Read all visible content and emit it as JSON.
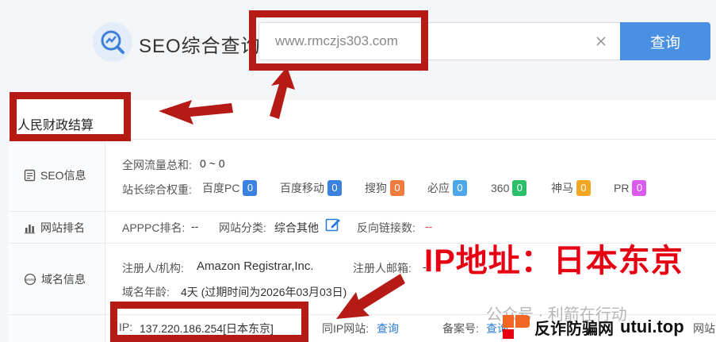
{
  "header": {
    "title": "SEO综合查询",
    "search_value": "www.rmczjs303.com",
    "search_button": "查询"
  },
  "site": {
    "name": "人民财政结算"
  },
  "sections": {
    "seo": "SEO信息",
    "rank": "网站排名",
    "domain": "域名信息"
  },
  "seo_info": {
    "traffic_label": "全网流量总和:",
    "traffic_value": "0 ~ 0",
    "weight_label": "站长综合权重:",
    "weights": [
      {
        "name": "百度PC",
        "value": "0",
        "color": "#3b82e0"
      },
      {
        "name": "百度移动",
        "value": "0",
        "color": "#3b82e0"
      },
      {
        "name": "搜狗",
        "value": "0",
        "color": "#f07b3f"
      },
      {
        "name": "必应",
        "value": "0",
        "color": "#4ea7e8"
      },
      {
        "name": "360",
        "value": "0",
        "color": "#2bbf6a"
      },
      {
        "name": "神马",
        "value": "0",
        "color": "#f5a623"
      },
      {
        "name": "PR",
        "value": "0",
        "color": "#d95bf0"
      }
    ]
  },
  "rank_info": {
    "apppc_label": "APPPC排名:",
    "apppc_value": "--",
    "category_label": "网站分类:",
    "category_value": "综合其他",
    "backlinks_label": "反向链接数:",
    "backlinks_value": "--"
  },
  "domain_info": {
    "registrant_label": "注册人/机构:",
    "registrant_value": "Amazon Registrar,Inc.",
    "email_label": "注册人邮箱:",
    "email_value": "-",
    "age_label": "域名年龄:",
    "age_value": "4天 (过期时间为2026年03月03日)",
    "ip_label": "IP:",
    "ip_value": "137.220.186.254[日本东京]",
    "same_ip_label": "同IP网站:",
    "same_ip_link": "查询",
    "icp_label": "备案号:",
    "icp_link": "查询",
    "tail_text": "网站"
  },
  "annotation": {
    "text": "IP地址：日本东京"
  },
  "watermark": {
    "line1": "公众号 · 利箭在行动",
    "brand": "反诈防骗网",
    "domain": "utui.top"
  },
  "colors": {
    "accent": "#4a90e2",
    "annotation_red": "#b51a14"
  }
}
